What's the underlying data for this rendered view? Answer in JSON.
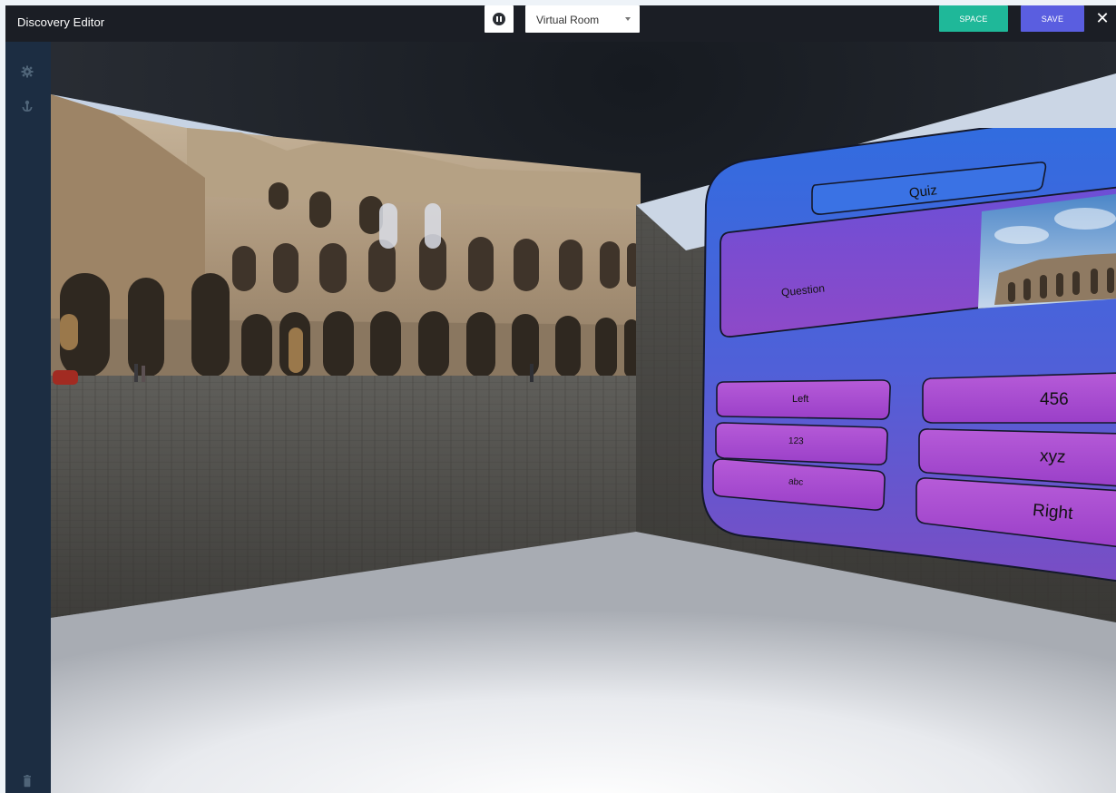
{
  "app": {
    "title": "Discovery Editor"
  },
  "toolbar": {
    "room_select_value": "Virtual Room",
    "space_label": "SPACE",
    "save_label": "SAVE",
    "close_label": "✕"
  },
  "sidebar": {
    "items": [
      {
        "icon": "gear-icon"
      },
      {
        "icon": "anchor-icon"
      },
      {
        "icon": "trash-icon"
      }
    ]
  },
  "quiz": {
    "title": "Quiz",
    "question": "Question",
    "left_answers": [
      "Left",
      "123",
      "abc"
    ],
    "right_answers": [
      "456",
      "xyz",
      "Right"
    ]
  },
  "colors": {
    "topbar": "#1b1e25",
    "sidebar": "#1c2d42",
    "space_button": "#1fb899",
    "save_button": "#5a5ee0",
    "quiz_panel_top": "#2f6de0",
    "quiz_panel_bottom": "#7a4dc4",
    "answer_button": "#b24fd6"
  }
}
